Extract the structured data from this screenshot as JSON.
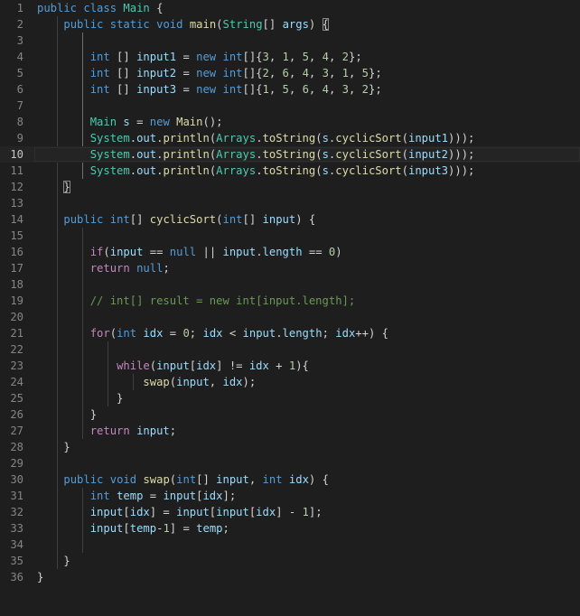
{
  "theme": {
    "background": "#1e1e1e",
    "line_number": "#858585",
    "keyword": "#569cd6",
    "control": "#c586c0",
    "type": "#4ec9b0",
    "function": "#dcdcaa",
    "variable": "#9cdcfe",
    "number": "#b5cea8",
    "comment": "#6a9955",
    "text": "#d4d4d4"
  },
  "editor": {
    "current_line": 10,
    "lines": [
      {
        "n": "1",
        "t": [
          [
            "kw",
            "public"
          ],
          [
            "pu",
            " "
          ],
          [
            "kw",
            "class"
          ],
          [
            "pu",
            " "
          ],
          [
            "ty",
            "Main"
          ],
          [
            "pu",
            " {"
          ]
        ]
      },
      {
        "n": "2",
        "t": [
          [
            "pu",
            "    "
          ],
          [
            "kw",
            "public"
          ],
          [
            "pu",
            " "
          ],
          [
            "kw",
            "static"
          ],
          [
            "pu",
            " "
          ],
          [
            "kw",
            "void"
          ],
          [
            "pu",
            " "
          ],
          [
            "fn",
            "main"
          ],
          [
            "pu",
            "("
          ],
          [
            "ty",
            "String"
          ],
          [
            "pu",
            "[] "
          ],
          [
            "va",
            "args"
          ],
          [
            "pu",
            ") "
          ],
          [
            "bm",
            "{"
          ]
        ]
      },
      {
        "n": "3",
        "t": []
      },
      {
        "n": "4",
        "t": [
          [
            "pu",
            "        "
          ],
          [
            "kw",
            "int"
          ],
          [
            "pu",
            " [] "
          ],
          [
            "va",
            "input1"
          ],
          [
            "pu",
            " = "
          ],
          [
            "kw",
            "new"
          ],
          [
            "pu",
            " "
          ],
          [
            "kw",
            "int"
          ],
          [
            "pu",
            "[]{"
          ],
          [
            "nu",
            "3"
          ],
          [
            "pu",
            ", "
          ],
          [
            "nu",
            "1"
          ],
          [
            "pu",
            ", "
          ],
          [
            "nu",
            "5"
          ],
          [
            "pu",
            ", "
          ],
          [
            "nu",
            "4"
          ],
          [
            "pu",
            ", "
          ],
          [
            "nu",
            "2"
          ],
          [
            "pu",
            "};"
          ]
        ]
      },
      {
        "n": "5",
        "t": [
          [
            "pu",
            "        "
          ],
          [
            "kw",
            "int"
          ],
          [
            "pu",
            " [] "
          ],
          [
            "va",
            "input2"
          ],
          [
            "pu",
            " = "
          ],
          [
            "kw",
            "new"
          ],
          [
            "pu",
            " "
          ],
          [
            "kw",
            "int"
          ],
          [
            "pu",
            "[]{"
          ],
          [
            "nu",
            "2"
          ],
          [
            "pu",
            ", "
          ],
          [
            "nu",
            "6"
          ],
          [
            "pu",
            ", "
          ],
          [
            "nu",
            "4"
          ],
          [
            "pu",
            ", "
          ],
          [
            "nu",
            "3"
          ],
          [
            "pu",
            ", "
          ],
          [
            "nu",
            "1"
          ],
          [
            "pu",
            ", "
          ],
          [
            "nu",
            "5"
          ],
          [
            "pu",
            "};"
          ]
        ]
      },
      {
        "n": "6",
        "t": [
          [
            "pu",
            "        "
          ],
          [
            "kw",
            "int"
          ],
          [
            "pu",
            " [] "
          ],
          [
            "va",
            "input3"
          ],
          [
            "pu",
            " = "
          ],
          [
            "kw",
            "new"
          ],
          [
            "pu",
            " "
          ],
          [
            "kw",
            "int"
          ],
          [
            "pu",
            "[]{"
          ],
          [
            "nu",
            "1"
          ],
          [
            "pu",
            ", "
          ],
          [
            "nu",
            "5"
          ],
          [
            "pu",
            ", "
          ],
          [
            "nu",
            "6"
          ],
          [
            "pu",
            ", "
          ],
          [
            "nu",
            "4"
          ],
          [
            "pu",
            ", "
          ],
          [
            "nu",
            "3"
          ],
          [
            "pu",
            ", "
          ],
          [
            "nu",
            "2"
          ],
          [
            "pu",
            "};"
          ]
        ]
      },
      {
        "n": "7",
        "t": []
      },
      {
        "n": "8",
        "t": [
          [
            "pu",
            "        "
          ],
          [
            "ty",
            "Main"
          ],
          [
            "pu",
            " "
          ],
          [
            "va",
            "s"
          ],
          [
            "pu",
            " = "
          ],
          [
            "kw",
            "new"
          ],
          [
            "pu",
            " "
          ],
          [
            "fn",
            "Main"
          ],
          [
            "pu",
            "();"
          ]
        ]
      },
      {
        "n": "9",
        "t": [
          [
            "pu",
            "        "
          ],
          [
            "ty",
            "System"
          ],
          [
            "pu",
            "."
          ],
          [
            "va",
            "out"
          ],
          [
            "pu",
            "."
          ],
          [
            "fn",
            "println"
          ],
          [
            "pu",
            "("
          ],
          [
            "ty",
            "Arrays"
          ],
          [
            "pu",
            "."
          ],
          [
            "fn",
            "toString"
          ],
          [
            "pu",
            "("
          ],
          [
            "va",
            "s"
          ],
          [
            "pu",
            "."
          ],
          [
            "fn",
            "cyclicSort"
          ],
          [
            "pu",
            "("
          ],
          [
            "va",
            "input1"
          ],
          [
            "pu",
            ")));"
          ]
        ]
      },
      {
        "n": "10",
        "t": [
          [
            "pu",
            "        "
          ],
          [
            "ty",
            "System"
          ],
          [
            "pu",
            "."
          ],
          [
            "va",
            "out"
          ],
          [
            "pu",
            "."
          ],
          [
            "fn",
            "println"
          ],
          [
            "pu",
            "("
          ],
          [
            "ty",
            "Arrays"
          ],
          [
            "pu",
            "."
          ],
          [
            "fn",
            "toString"
          ],
          [
            "pu",
            "("
          ],
          [
            "va",
            "s"
          ],
          [
            "pu",
            "."
          ],
          [
            "fn",
            "cyclicSort"
          ],
          [
            "pu",
            "("
          ],
          [
            "va",
            "input2"
          ],
          [
            "pu",
            ")));"
          ]
        ]
      },
      {
        "n": "11",
        "t": [
          [
            "pu",
            "        "
          ],
          [
            "ty",
            "System"
          ],
          [
            "pu",
            "."
          ],
          [
            "va",
            "out"
          ],
          [
            "pu",
            "."
          ],
          [
            "fn",
            "println"
          ],
          [
            "pu",
            "("
          ],
          [
            "ty",
            "Arrays"
          ],
          [
            "pu",
            "."
          ],
          [
            "fn",
            "toString"
          ],
          [
            "pu",
            "("
          ],
          [
            "va",
            "s"
          ],
          [
            "pu",
            "."
          ],
          [
            "fn",
            "cyclicSort"
          ],
          [
            "pu",
            "("
          ],
          [
            "va",
            "input3"
          ],
          [
            "pu",
            ")));"
          ]
        ]
      },
      {
        "n": "12",
        "t": [
          [
            "pu",
            "    "
          ],
          [
            "bm",
            "}"
          ]
        ]
      },
      {
        "n": "13",
        "t": []
      },
      {
        "n": "14",
        "t": [
          [
            "pu",
            "    "
          ],
          [
            "kw",
            "public"
          ],
          [
            "pu",
            " "
          ],
          [
            "kw",
            "int"
          ],
          [
            "pu",
            "[] "
          ],
          [
            "fn",
            "cyclicSort"
          ],
          [
            "pu",
            "("
          ],
          [
            "kw",
            "int"
          ],
          [
            "pu",
            "[] "
          ],
          [
            "va",
            "input"
          ],
          [
            "pu",
            ") {"
          ]
        ]
      },
      {
        "n": "15",
        "t": []
      },
      {
        "n": "16",
        "t": [
          [
            "pu",
            "        "
          ],
          [
            "ctl",
            "if"
          ],
          [
            "pu",
            "("
          ],
          [
            "va",
            "input"
          ],
          [
            "pu",
            " == "
          ],
          [
            "kw",
            "null"
          ],
          [
            "pu",
            " || "
          ],
          [
            "va",
            "input"
          ],
          [
            "pu",
            "."
          ],
          [
            "va",
            "length"
          ],
          [
            "pu",
            " == "
          ],
          [
            "nu",
            "0"
          ],
          [
            "pu",
            ")"
          ]
        ]
      },
      {
        "n": "17",
        "t": [
          [
            "pu",
            "        "
          ],
          [
            "ctl",
            "return"
          ],
          [
            "pu",
            " "
          ],
          [
            "kw",
            "null"
          ],
          [
            "pu",
            ";"
          ]
        ]
      },
      {
        "n": "18",
        "t": []
      },
      {
        "n": "19",
        "t": [
          [
            "pu",
            "        "
          ],
          [
            "cm",
            "// int[] result = new int[input.length];"
          ]
        ]
      },
      {
        "n": "20",
        "t": []
      },
      {
        "n": "21",
        "t": [
          [
            "pu",
            "        "
          ],
          [
            "ctl",
            "for"
          ],
          [
            "pu",
            "("
          ],
          [
            "kw",
            "int"
          ],
          [
            "pu",
            " "
          ],
          [
            "va",
            "idx"
          ],
          [
            "pu",
            " = "
          ],
          [
            "nu",
            "0"
          ],
          [
            "pu",
            "; "
          ],
          [
            "va",
            "idx"
          ],
          [
            "pu",
            " < "
          ],
          [
            "va",
            "input"
          ],
          [
            "pu",
            "."
          ],
          [
            "va",
            "length"
          ],
          [
            "pu",
            "; "
          ],
          [
            "va",
            "idx"
          ],
          [
            "pu",
            "++) {"
          ]
        ]
      },
      {
        "n": "22",
        "t": []
      },
      {
        "n": "23",
        "t": [
          [
            "pu",
            "            "
          ],
          [
            "ctl",
            "while"
          ],
          [
            "pu",
            "("
          ],
          [
            "va",
            "input"
          ],
          [
            "pu",
            "["
          ],
          [
            "va",
            "idx"
          ],
          [
            "pu",
            "] != "
          ],
          [
            "va",
            "idx"
          ],
          [
            "pu",
            " + "
          ],
          [
            "nu",
            "1"
          ],
          [
            "pu",
            "){"
          ]
        ]
      },
      {
        "n": "24",
        "t": [
          [
            "pu",
            "                "
          ],
          [
            "fn",
            "swap"
          ],
          [
            "pu",
            "("
          ],
          [
            "va",
            "input"
          ],
          [
            "pu",
            ", "
          ],
          [
            "va",
            "idx"
          ],
          [
            "pu",
            ");"
          ]
        ]
      },
      {
        "n": "25",
        "t": [
          [
            "pu",
            "            }"
          ]
        ]
      },
      {
        "n": "26",
        "t": [
          [
            "pu",
            "        }"
          ]
        ]
      },
      {
        "n": "27",
        "t": [
          [
            "pu",
            "        "
          ],
          [
            "ctl",
            "return"
          ],
          [
            "pu",
            " "
          ],
          [
            "va",
            "input"
          ],
          [
            "pu",
            ";"
          ]
        ]
      },
      {
        "n": "28",
        "t": [
          [
            "pu",
            "    }"
          ]
        ]
      },
      {
        "n": "29",
        "t": []
      },
      {
        "n": "30",
        "t": [
          [
            "pu",
            "    "
          ],
          [
            "kw",
            "public"
          ],
          [
            "pu",
            " "
          ],
          [
            "kw",
            "void"
          ],
          [
            "pu",
            " "
          ],
          [
            "fn",
            "swap"
          ],
          [
            "pu",
            "("
          ],
          [
            "kw",
            "int"
          ],
          [
            "pu",
            "[] "
          ],
          [
            "va",
            "input"
          ],
          [
            "pu",
            ", "
          ],
          [
            "kw",
            "int"
          ],
          [
            "pu",
            " "
          ],
          [
            "va",
            "idx"
          ],
          [
            "pu",
            ") {"
          ]
        ]
      },
      {
        "n": "31",
        "t": [
          [
            "pu",
            "        "
          ],
          [
            "kw",
            "int"
          ],
          [
            "pu",
            " "
          ],
          [
            "va",
            "temp"
          ],
          [
            "pu",
            " = "
          ],
          [
            "va",
            "input"
          ],
          [
            "pu",
            "["
          ],
          [
            "va",
            "idx"
          ],
          [
            "pu",
            "];"
          ]
        ]
      },
      {
        "n": "32",
        "t": [
          [
            "pu",
            "        "
          ],
          [
            "va",
            "input"
          ],
          [
            "pu",
            "["
          ],
          [
            "va",
            "idx"
          ],
          [
            "pu",
            "] = "
          ],
          [
            "va",
            "input"
          ],
          [
            "pu",
            "["
          ],
          [
            "va",
            "input"
          ],
          [
            "pu",
            "["
          ],
          [
            "va",
            "idx"
          ],
          [
            "pu",
            "] - "
          ],
          [
            "nu",
            "1"
          ],
          [
            "pu",
            "];"
          ]
        ]
      },
      {
        "n": "33",
        "t": [
          [
            "pu",
            "        "
          ],
          [
            "va",
            "input"
          ],
          [
            "pu",
            "["
          ],
          [
            "va",
            "temp"
          ],
          [
            "pu",
            "-"
          ],
          [
            "nu",
            "1"
          ],
          [
            "pu",
            "] = "
          ],
          [
            "va",
            "temp"
          ],
          [
            "pu",
            ";"
          ]
        ]
      },
      {
        "n": "34",
        "t": []
      },
      {
        "n": "35",
        "t": [
          [
            "pu",
            "    }"
          ]
        ]
      },
      {
        "n": "36",
        "t": [
          [
            "pu",
            "}"
          ]
        ]
      }
    ]
  }
}
